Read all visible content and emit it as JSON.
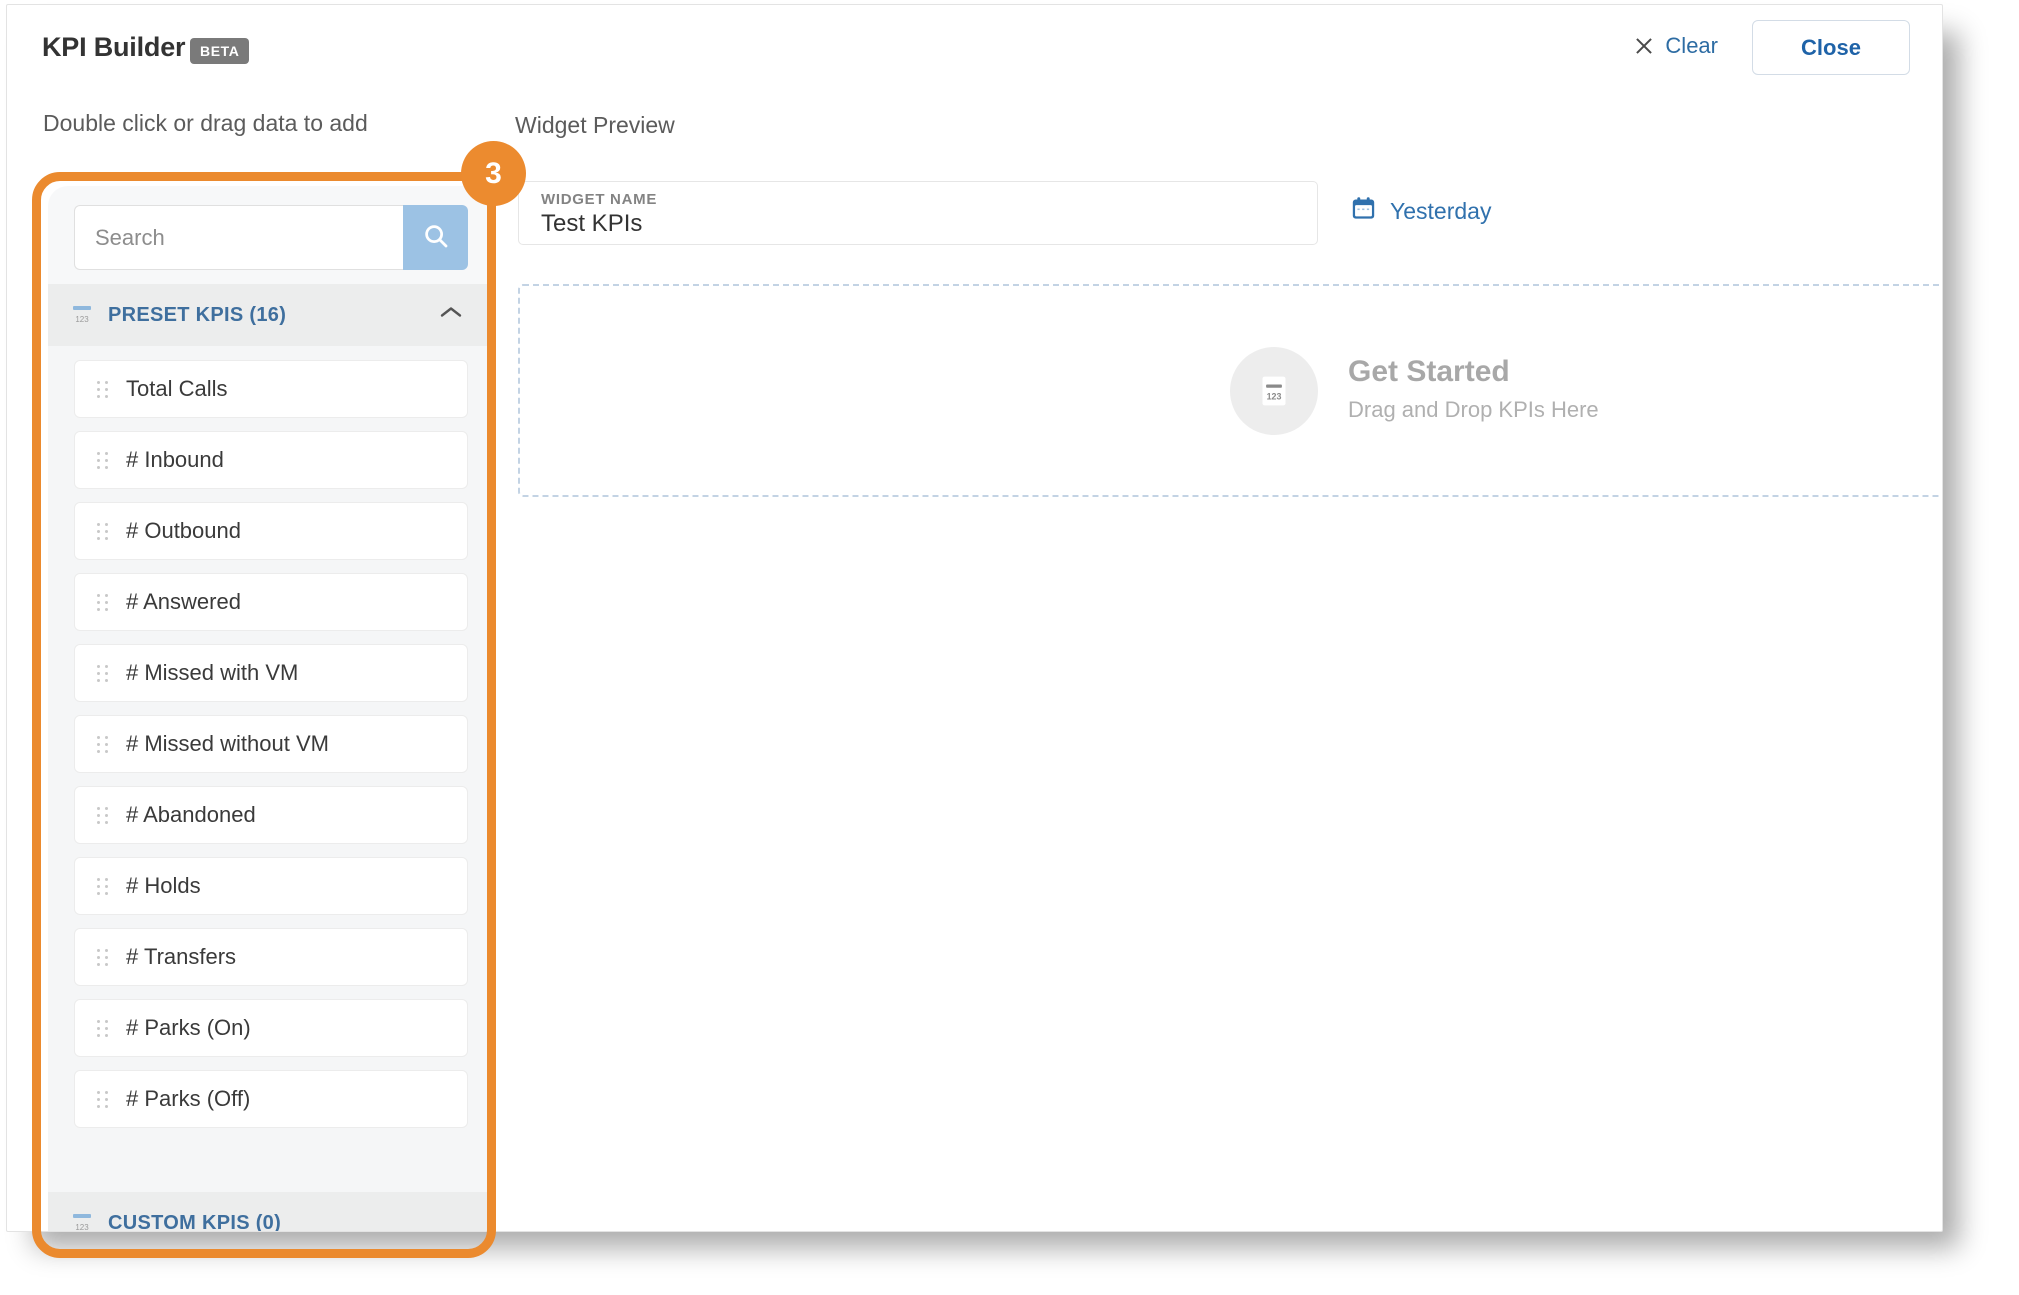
{
  "header": {
    "title": "KPI Builder",
    "beta_badge": "BETA",
    "clear_label": "Clear",
    "close_label": "Close"
  },
  "captions": {
    "left": "Double click or drag data to add",
    "right": "Widget Preview"
  },
  "annotation": {
    "step_number": "3",
    "highlight_color": "#eb8a2e"
  },
  "search": {
    "placeholder": "Search",
    "value": "",
    "icon": "search-icon"
  },
  "groups": {
    "preset": {
      "label": "PRESET KPIS (16)",
      "icon": "kpi-123-icon",
      "expanded": true,
      "chevron": "chevron-up-icon"
    },
    "custom": {
      "label": "CUSTOM KPIS (0)",
      "icon": "kpi-123-icon",
      "expanded": false
    }
  },
  "kpis": [
    {
      "label": "Total Calls"
    },
    {
      "label": "# Inbound"
    },
    {
      "label": "# Outbound"
    },
    {
      "label": "# Answered"
    },
    {
      "label": "# Missed with VM"
    },
    {
      "label": "# Missed without VM"
    },
    {
      "label": "# Abandoned"
    },
    {
      "label": "# Holds"
    },
    {
      "label": "# Transfers"
    },
    {
      "label": "# Parks (On)"
    },
    {
      "label": "# Parks (Off)"
    }
  ],
  "widget": {
    "name_label": "WIDGET NAME",
    "name_value": "Test KPIs",
    "name_placeholder": "Widget Name"
  },
  "daterange": {
    "label": "Yesterday",
    "icon": "calendar-icon"
  },
  "dropzone": {
    "title": "Get Started",
    "subtitle": "Drag and Drop KPIs Here",
    "icon": "kpi-card-123-icon"
  },
  "colors": {
    "accent_blue": "#2d6ca3",
    "highlight_orange": "#eb8a2e",
    "search_button": "#9cc2e4",
    "panel_bg": "#f7f8f9"
  }
}
